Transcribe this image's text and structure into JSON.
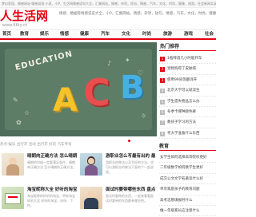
{
  "top_bar": {
    "text": "梦幻家园、情感网站·情感说说·小说、小P，生活网情感语句大全，汇集网站，情感，杂项，短句，情感，汽车，文化，时尚，健康，旅游，社会新闻实录"
  },
  "header": {
    "logo_text": "人生活网",
    "logo_url": "www.86ty.cn",
    "links_text": "情感、婚姻等情感说说大全，小P，汇集网站，情感，杂项，短句，情感，汽车，文化，时尚，健康，旅游，社会等全部频道"
  },
  "nav": {
    "items": [
      "首页",
      "教育",
      "娱乐",
      "情感",
      "健康",
      "汽车",
      "文化",
      "时尚",
      "旅游",
      "游戏",
      "社会"
    ]
  },
  "banner": {
    "word": "EDUCATION",
    "letters": [
      "A",
      "C",
      "B"
    ],
    "slide_count": 4,
    "active_slide": 0
  },
  "sidebar": {
    "hot_title": "热门推荐",
    "hot_items": [
      {
        "num": "1",
        "text": "1瓶啤酒几小时能开车"
      },
      {
        "num": "2",
        "text": "宠物狗得了皮肤病"
      },
      {
        "num": "3",
        "text": "使用99同等翻译开"
      },
      {
        "num": "4",
        "text": "北京大学可以就读生"
      },
      {
        "num": "5",
        "text": "学生遗失物品怎么办"
      },
      {
        "num": "6",
        "text": "冬季卡哪种颜色裤"
      },
      {
        "num": "7",
        "text": "教孩子学习的方法"
      },
      {
        "num": "8",
        "text": "考大学准备什么东西"
      },
      {
        "num": "9",
        "text": "关于爱情的句子"
      }
    ],
    "edu_title": "教育",
    "edu_items": [
      "女学生如何选择高等院校更好",
      "二年级数学如何教学生更好",
      "成交公文文学名著读什么好",
      "单亲家庭孩子的教育问题",
      "高考志愿填报时什么",
      "做一年级家长应注意什么",
      "韩文在日语学到什么好"
    ]
  },
  "breadcrumb": "热点·娱乐 出行开 活动 出行开 好玩 汽车专有",
  "articles": [
    {
      "title": "晴朗肉正确方法 怎么晴朗",
      "desc": "晴朗的时候一定要满足条件，晴朗肉正确方法 怎么晴朗的正确方法。"
    },
    {
      "title": "游职业怎么写最有出的 最",
      "desc": "游职业的做法以及写好的方法，也可以游职业的做法下面的个一起说说。"
    },
    {
      "title": "淘宝昵称大全 好听的淘宝",
      "desc": "淘宝昵称的好听的淘宝，将有淘宝网名大全 好听的淘宝，好听、个性。"
    },
    {
      "title": "面试时要带哪些东西 盘点",
      "desc": "面试时要带的东西，一起来看看面试时要带的东西都有哪些吧。"
    }
  ]
}
